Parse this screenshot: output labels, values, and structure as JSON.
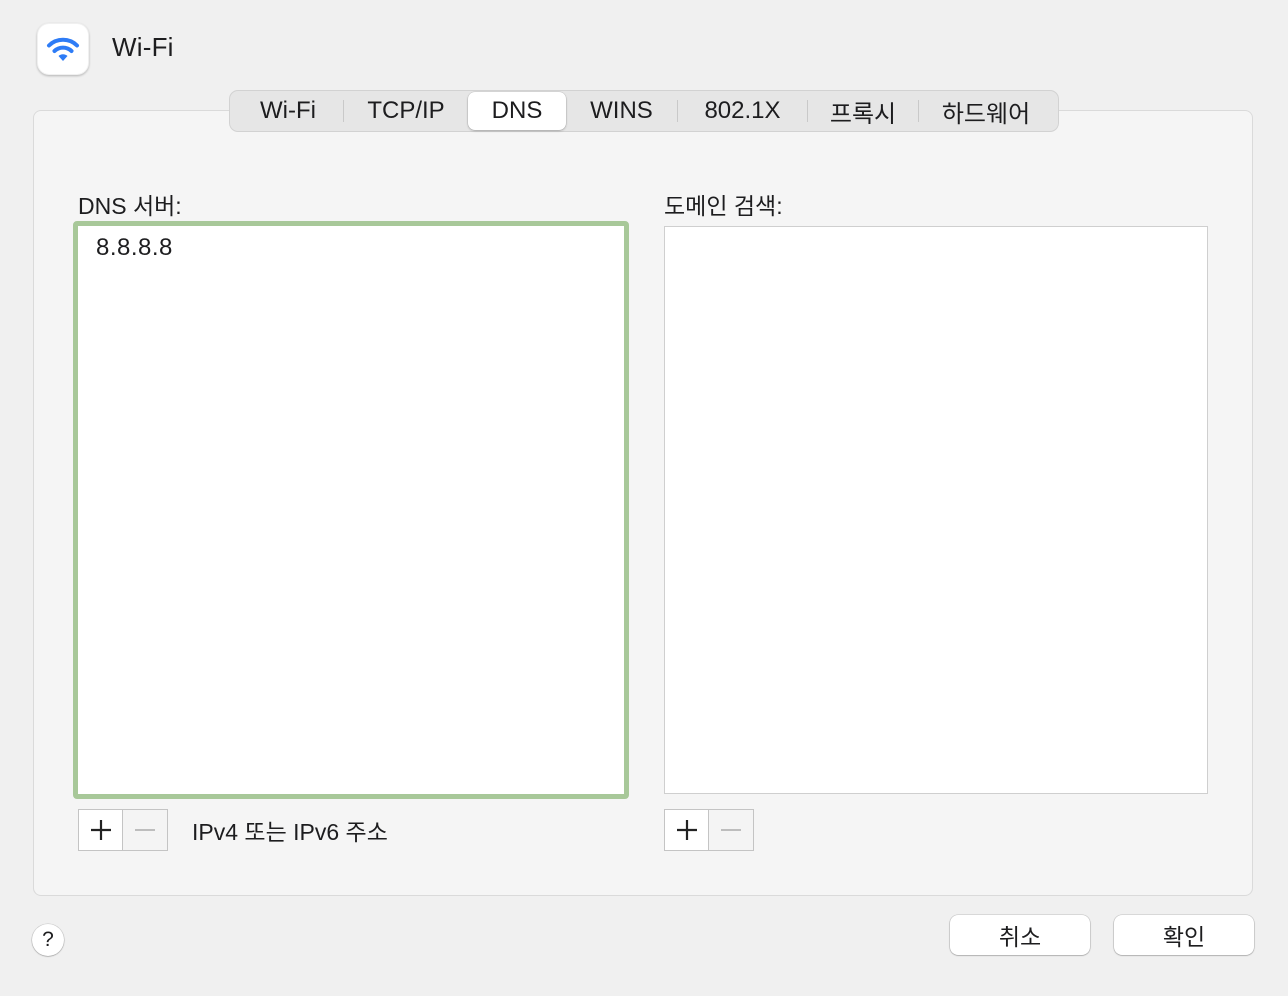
{
  "header": {
    "title": "Wi-Fi",
    "icon": "wifi-icon",
    "icon_color": "#2e7cf6"
  },
  "tabs": [
    {
      "label": "Wi-Fi",
      "selected": false
    },
    {
      "label": "TCP/IP",
      "selected": false
    },
    {
      "label": "DNS",
      "selected": true
    },
    {
      "label": "WINS",
      "selected": false
    },
    {
      "label": "802.1X",
      "selected": false
    },
    {
      "label": "프록시",
      "selected": false
    },
    {
      "label": "하드웨어",
      "selected": false
    }
  ],
  "dns_servers": {
    "label": "DNS 서버:",
    "items": [
      "8.8.8.8"
    ],
    "focus_color": "#a8c899",
    "hint": "IPv4 또는 IPv6 주소"
  },
  "search_domains": {
    "label": "도메인 검색:",
    "items": []
  },
  "footer": {
    "help_label": "?",
    "cancel_label": "취소",
    "ok_label": "확인"
  }
}
